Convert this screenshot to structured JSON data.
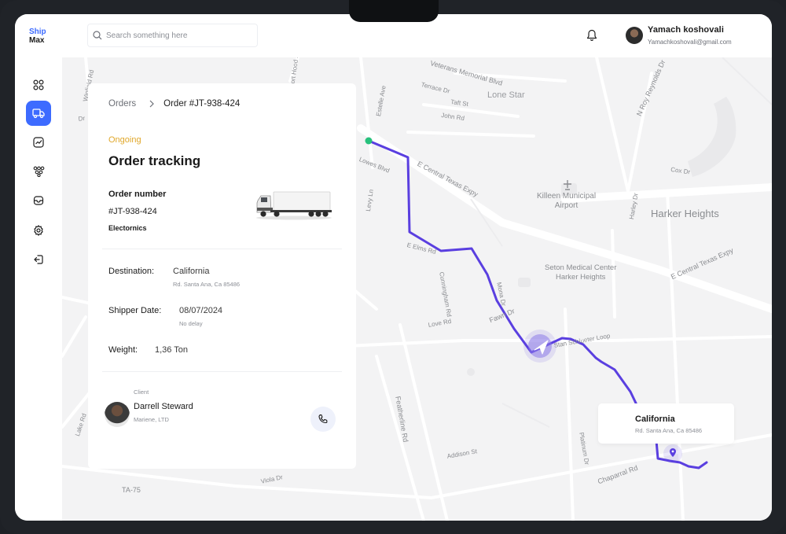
{
  "app": {
    "logo_line1": "Ship",
    "logo_line2": "Max"
  },
  "search": {
    "placeholder": "Search something here"
  },
  "user": {
    "name": "Yamach koshovali",
    "email": "Yamachkoshovali@gmail.com"
  },
  "sidebar": {
    "items": [
      {
        "icon": "dashboard-icon",
        "active": false
      },
      {
        "icon": "truck-icon",
        "active": true
      },
      {
        "icon": "chart-icon",
        "active": false
      },
      {
        "icon": "network-icon",
        "active": false
      },
      {
        "icon": "box-icon",
        "active": false
      },
      {
        "icon": "gear-icon",
        "active": false
      },
      {
        "icon": "logout-icon",
        "active": false
      }
    ]
  },
  "breadcrumb": {
    "root": "Orders",
    "current": "Order #JT-938-424"
  },
  "order": {
    "status": "Ongoing",
    "title": "Order tracking",
    "number_label": "Order number",
    "number": "#JT-938-424",
    "category": "Electornics",
    "destination_label": "Destination:",
    "destination": "California",
    "destination_address": "Rd. Santa Ana, Ca 85486",
    "date_label": "Shipper Date:",
    "date": "08/07/2024",
    "date_note": "No delay",
    "weight_label": "Weight:",
    "weight": "1,36 Ton"
  },
  "client": {
    "label": "Client",
    "name": "Darrell Steward",
    "company": "Mariene, LTD"
  },
  "destination_popup": {
    "name": "California",
    "address": "Rd. Santa Ana, Ca 85486"
  },
  "map_labels": {
    "memorial_blvd": "Veterans Memorial Blvd",
    "terrace_dr": "Terrace Dr",
    "taft_st": "Taft St",
    "john_rd": "John Rd",
    "lone_star": "Lone Star",
    "n_roy_reynolds": "N Roy Reynolds Dr",
    "estelle_ave": "Estelle Ave",
    "lowes_blvd": "Lowes Blvd",
    "e_central_texas": "E Central Texas Expy",
    "cox_dr": "Cox Dr",
    "airport": "Killeen Municipal\nAirport",
    "harker_heights": "Harker Heights",
    "harley_dr": "Harley Dr",
    "levy_ln": "Levy Ln",
    "e_elms_rd": "E Elms Rd",
    "seton": "Seton Medical Center\nHarker Heights",
    "e_central_texas_2": "E Central Texas Expy",
    "mona_dr": "Mona Dr",
    "cunningham_rd": "Cunningham Rd",
    "fawn_dr": "Fawn Dr",
    "love_rd": "Love Rd",
    "stan_schlueter": "Stan Schlueter Loop",
    "winfield_rd": "Winfield Rd",
    "s_fort_hood": "S Fort Hood St",
    "featherline_rd": "Featherline Rd",
    "addison_st": "Addison St",
    "platinum_dr": "Platinum Dr",
    "chaparral_rd": "Chaparral Rd",
    "viola_dr": "Viola Dr",
    "ta75": "TA-75",
    "lake_rd": "Lake Rd",
    "dr": "Dr"
  },
  "colors": {
    "accent": "#3d6bff",
    "route": "#5a3fe0",
    "status": "#e0a72a",
    "origin": "#27c17c"
  }
}
